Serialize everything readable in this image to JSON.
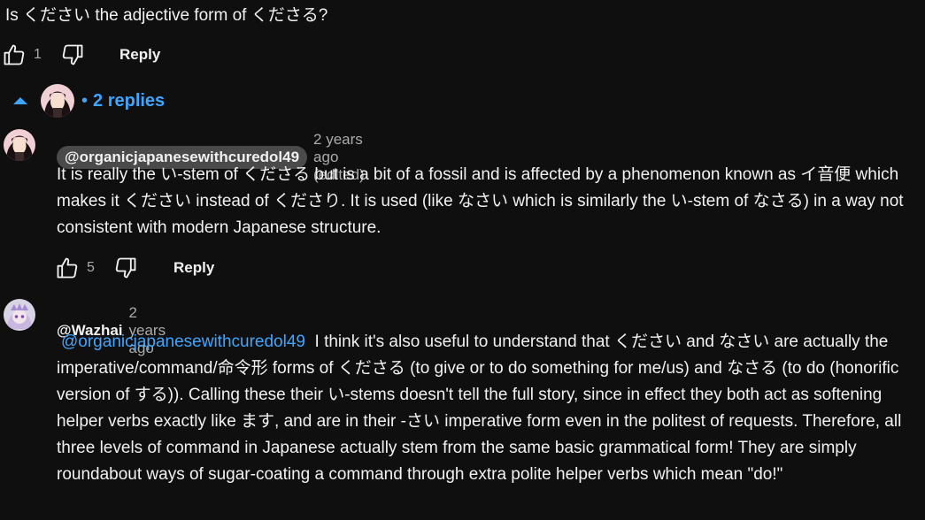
{
  "parent_comment": {
    "text": "Is ください the adjective form of くださる?",
    "like_count": "1",
    "reply_label": "Reply"
  },
  "replies_toggle": {
    "label": "2 replies",
    "bullet": "•"
  },
  "replies": [
    {
      "author": "@organicjapanesewithcuredol49",
      "time": "2 years ago (edited)",
      "text": "It is really the い-stem of くださる but is a bit of a fossil and is affected by a phenomenon known as イ音便 which makes it ください instead of くださり. It is used (like なさい which is similarly the い-stem of なさる) in a way not consistent with modern Japanese structure.",
      "like_count": "5",
      "reply_label": "Reply"
    },
    {
      "author": "@Wazhai",
      "time": "2 years ago",
      "mention": "@organicjapanesewithcuredol49",
      "text": "I think it's also useful to understand that ください and なさい are actually the imperative/command/命令形 forms of くださる (to give or to do something for me/us) and なさる (to do (honorific version of する)). Calling these their い-stems doesn't tell the full story, since in effect they both act as softening helper verbs exactly like ます, and are in their -さい imperative form even in the politest of requests. Therefore, all three levels of command in Japanese actually stem from the same basic grammatical form! They are simply roundabout ways of sugar-coating a command through extra polite helper verbs which mean \"do!\""
    }
  ],
  "colors": {
    "background": "#0f0f0f",
    "text": "#f1f1f1",
    "secondary_text": "#aaaaaa",
    "link": "#3ea6ff",
    "chip": "#4a4a4a"
  }
}
